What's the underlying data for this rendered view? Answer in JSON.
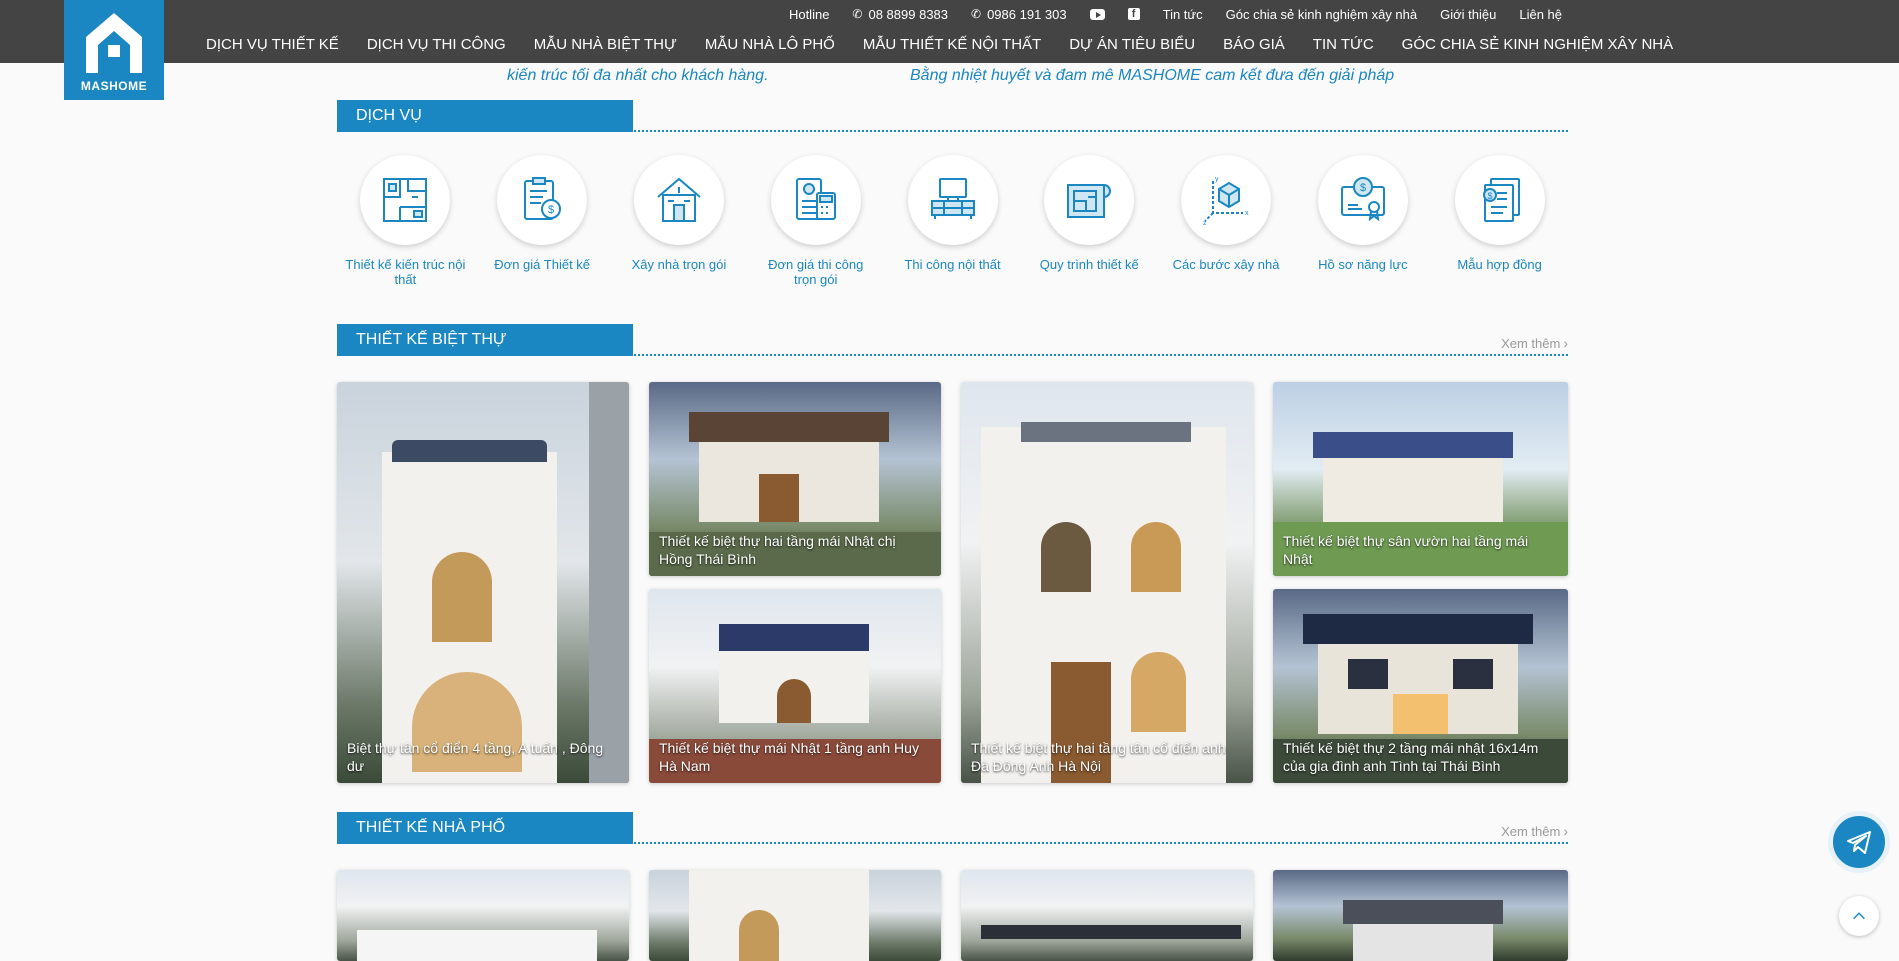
{
  "logo": {
    "text": "MASHOME"
  },
  "topbar": {
    "hotline_label": "Hotline",
    "phone1": "08 8899 8383",
    "phone2": "0986 191 303",
    "youtube_icon": "youtube-icon",
    "facebook_icon": "facebook-icon",
    "links": [
      "Tin tức",
      "Góc chia sẻ kinh nghiệm xây nhà",
      "Giới thiệu",
      "Liên hệ"
    ]
  },
  "nav": [
    "DỊCH VỤ THIẾT KẾ",
    "DỊCH VỤ THI CÔNG",
    "MẪU NHÀ BIỆT THỰ",
    "MẪU NHÀ LÔ PHỐ",
    "MẪU THIẾT KẾ NỘI THẤT",
    "DỰ ÁN TIÊU BIỂU",
    "BÁO GIÁ",
    "TIN TỨC",
    "GÓC CHIA SẺ KINH NGHIỆM XÂY NHÀ"
  ],
  "slogan": {
    "left": "kiến trúc tối đa nhất cho khách hàng.",
    "right": "Bằng nhiệt huyết và đam mê MASHOME cam kết đưa đến giải pháp"
  },
  "services_section": {
    "title": "DỊCH VỤ",
    "items": [
      {
        "label": "Thiết kế kiến trúc nội thất",
        "icon": "floorplan-icon"
      },
      {
        "label": "Đơn giá Thiết kế",
        "icon": "clipboard-price-icon"
      },
      {
        "label": "Xây nhà trọn gói",
        "icon": "house-build-icon"
      },
      {
        "label": "Đơn giá thi công trọn gói",
        "icon": "calculator-price-icon"
      },
      {
        "label": "Thi công nội thất",
        "icon": "furniture-icon"
      },
      {
        "label": "Quy trình thiết kế",
        "icon": "blueprint-icon"
      },
      {
        "label": "Các bước xây nhà",
        "icon": "axis-box-icon"
      },
      {
        "label": "Hồ sơ năng lực",
        "icon": "certificate-icon"
      },
      {
        "label": "Mẫu hợp đồng",
        "icon": "contract-icon"
      }
    ]
  },
  "villa_section": {
    "title": "THIẾT KẾ BIỆT THỰ",
    "see_more": "Xem thêm",
    "cards": [
      "Biệt thự tân cổ điển 4 tầng, A tuấn , Đông dư",
      "Thiết kế biệt thự hai tầng mái Nhật chị Hồng Thái Bình",
      "Thiết kế biệt thự mái Nhật 1 tầng anh Huy Hà Nam",
      "Thiết kế biệt thự hai tầng tân cổ điển anh Đà Đông Anh Hà Nội",
      "Thiết kế biệt thự sân vườn hai tầng mái Nhật",
      "Thiết kế biệt thự 2 tầng mái nhật 16x14m của gia đình anh Tình tại Thái Bình"
    ]
  },
  "townhouse_section": {
    "title": "THIẾT KẾ NHÀ PHỐ",
    "see_more": "Xem thêm"
  },
  "colors": {
    "brand": "#1a87c2",
    "header": "#444444"
  }
}
